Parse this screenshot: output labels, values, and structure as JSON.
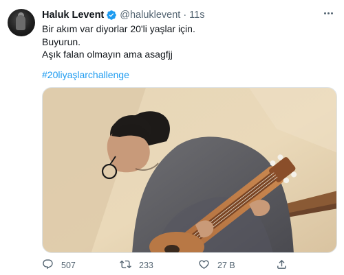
{
  "tweet": {
    "author_name": "Haluk Levent",
    "handle": "@haluklevent",
    "separator": "·",
    "time": "11s",
    "lines": [
      "Bir akım var diyorlar 20'li yaşlar için.",
      "Buyurun.",
      "Aşık falan olmayın ama asagfjj"
    ],
    "hashtag": "#20liyaşlarchallenge"
  },
  "actions": {
    "reply_count": "507",
    "retweet_count": "233",
    "like_count": "27 B",
    "share_label": ""
  },
  "colors": {
    "link": "#1d9bf0",
    "secondary_text": "#536471",
    "verified_badge": "#1d9bf0"
  },
  "icons": {
    "verified": "verified-badge-icon",
    "more": "more-options-icon",
    "reply": "reply-icon",
    "retweet": "retweet-icon",
    "like": "heart-icon",
    "share": "share-icon"
  }
}
